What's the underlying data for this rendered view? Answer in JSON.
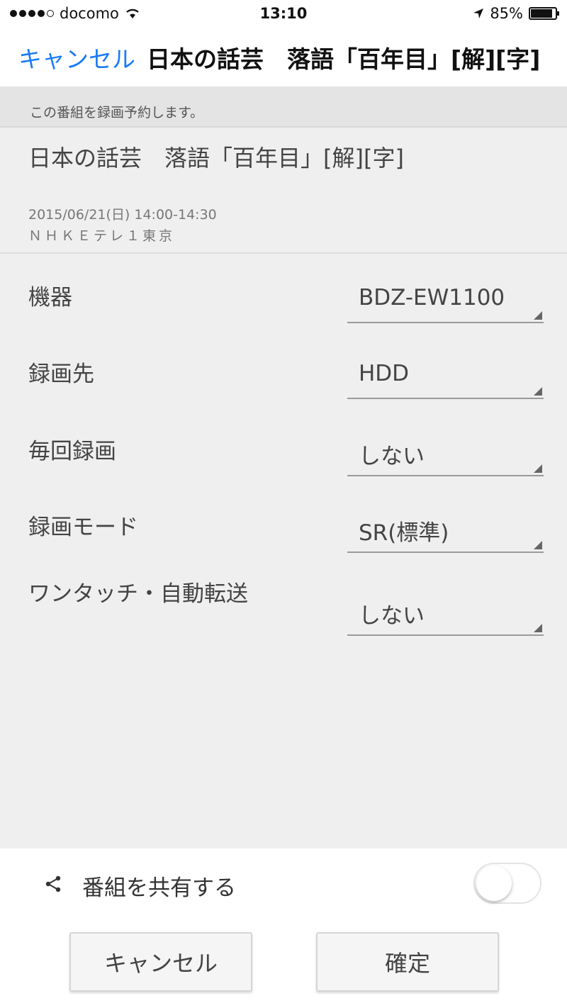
{
  "status_bar": {
    "carrier": "docomo",
    "time": "13:10",
    "battery_percent": "85%",
    "battery_level": 0.85,
    "icons": [
      "signal-dots-icon",
      "wifi-icon",
      "location-arrow-icon",
      "battery-icon"
    ]
  },
  "nav": {
    "cancel_label": "キャンセル",
    "title": "日本の話芸　落語「百年目」[解][字]",
    "accent_color": "#1a7cf5"
  },
  "notice": "この番組を録画予約します。",
  "program": {
    "title": "日本の話芸　落語「百年目」[解][字]",
    "datetime": "2015/06/21(日) 14:00-14:30",
    "channel": "ＮＨＫＥテレ１東京"
  },
  "settings": [
    {
      "label": "機器",
      "value": "BDZ-EW1100"
    },
    {
      "label": "録画先",
      "value": "HDD"
    },
    {
      "label": "毎回録画",
      "value": "しない"
    },
    {
      "label": "録画モード",
      "value": "SR(標準)"
    },
    {
      "label": "ワンタッチ・自動転送",
      "value": "しない"
    }
  ],
  "share": {
    "label": "番組を共有する",
    "enabled": false
  },
  "buttons": {
    "cancel_label": "キャンセル",
    "confirm_label": "確定"
  }
}
